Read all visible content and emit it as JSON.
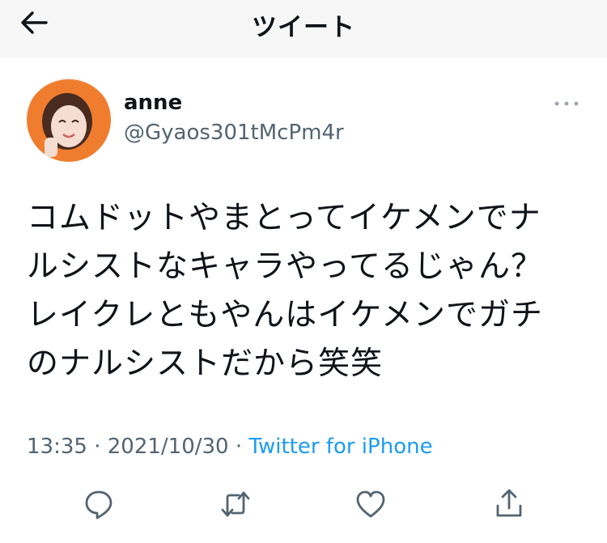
{
  "header": {
    "title": "ツイート",
    "back_icon": "arrow-left-icon"
  },
  "tweet": {
    "author_name": "anne",
    "author_handle": "@Gyaos301tMcPm4r",
    "text": "コムドットやまとってイケメンでナ\nルシストなキャラやってるじゃん？\nレイクレともやんはイケメンでガチ\nのナルシストだから笑笑",
    "time": "13:35",
    "separator": "·",
    "date": "2021/10/30",
    "source": "Twitter for iPhone"
  },
  "actions": [
    "reply-icon",
    "retweet-icon",
    "like-icon",
    "share-icon"
  ],
  "colors": {
    "link": "#1d9bf0",
    "secondary": "#536471",
    "header_bg": "#f7f7f7",
    "avatar_accent": "#f07d2e"
  }
}
